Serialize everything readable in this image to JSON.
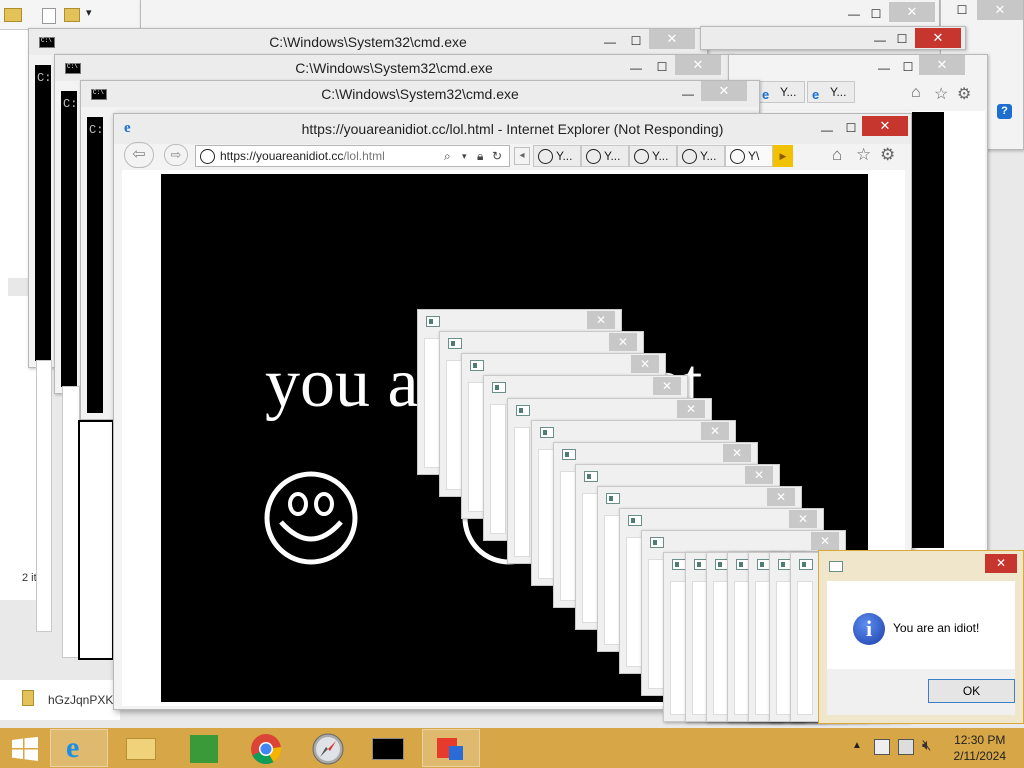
{
  "cmd_windows": [
    {
      "title": "C:\\Windows\\System32\\cmd.exe",
      "prompt": "C:"
    },
    {
      "title": "C:\\Windows\\System32\\cmd.exe",
      "prompt": "C:"
    },
    {
      "title": "C:\\Windows\\System32\\cmd.exe",
      "prompt": "C:"
    }
  ],
  "explorer": {
    "items_count_text": "2 it",
    "file_name": "hGzJqnPXK"
  },
  "ie_background": {
    "tab_labels": [
      "Y...",
      "Y..."
    ]
  },
  "ie": {
    "title": "https://youareanidiot.cc/lol.html - Internet Explorer (Not Responding)",
    "address_host": "https://youareanidiot.cc",
    "address_path": "/lol.html",
    "tabs": [
      "Y...",
      "Y...",
      "Y...",
      "Y...",
      "Y\\"
    ],
    "page_text": "you are an idiot"
  },
  "message_box": {
    "text": "You are an idiot!",
    "ok_label": "OK"
  },
  "window_controls": {
    "minimize": "—",
    "maximize": "☐",
    "close": "✕"
  },
  "taskbar": {
    "apps": [
      "start-button",
      "internet-explorer",
      "file-explorer",
      "windows-store",
      "chrome",
      "safari",
      "command-prompt",
      "virtualbox"
    ],
    "time": "12:30 PM",
    "date": "2/11/2024"
  },
  "colors": {
    "taskbar": "#d7a646",
    "close_active": "#c7352f",
    "page_bg": "#000000"
  }
}
